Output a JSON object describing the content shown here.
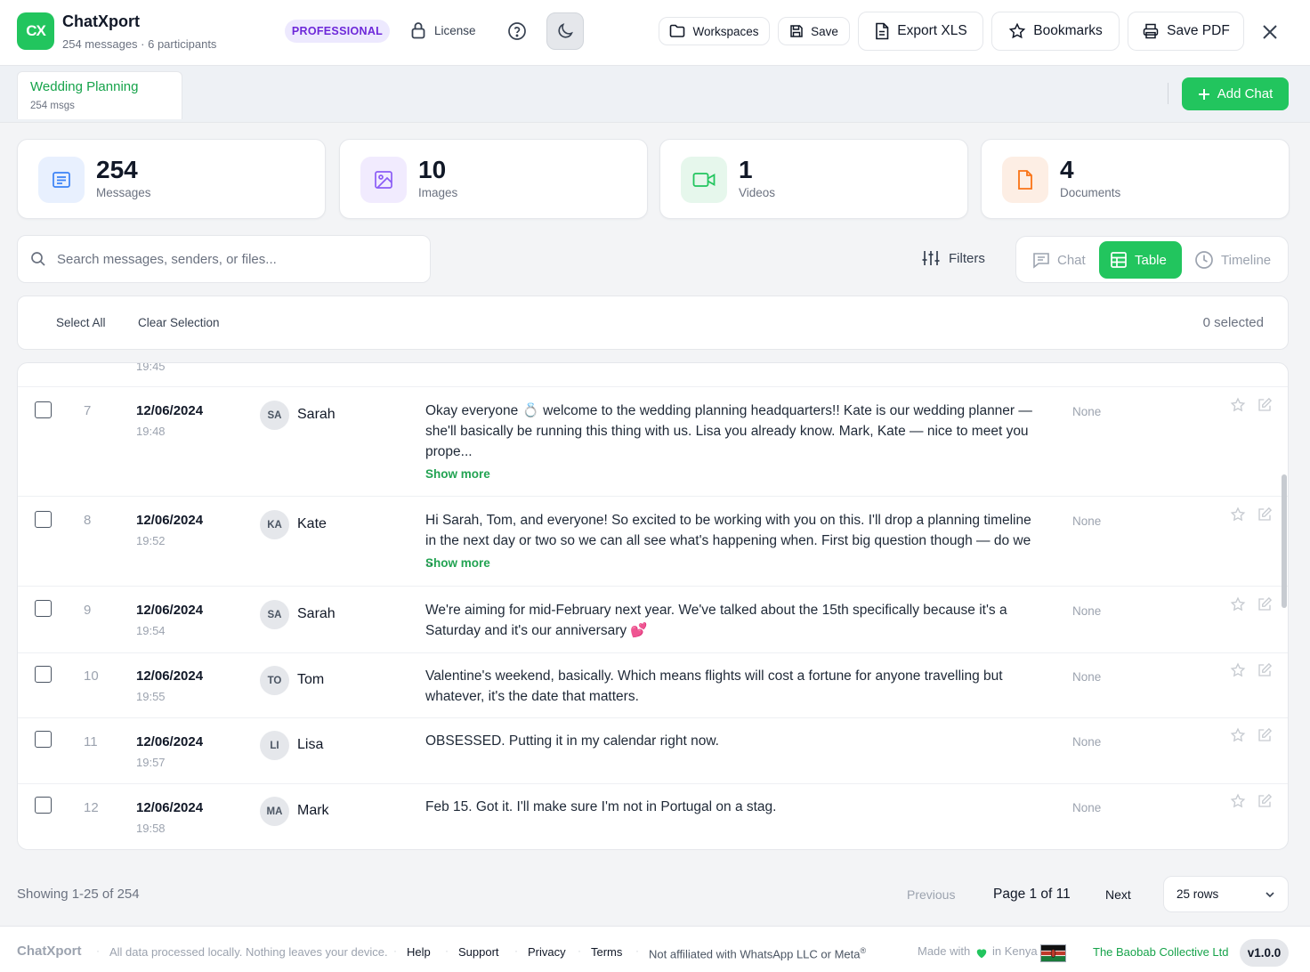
{
  "app": {
    "logo_text": "CX",
    "title": "ChatXport",
    "subtitle": "254 messages · 6 participants",
    "plan_badge": "PROFESSIONAL",
    "license_label": "License"
  },
  "toolbar": {
    "workspaces": "Workspaces",
    "save": "Save",
    "export_xls": "Export XLS",
    "bookmarks": "Bookmarks",
    "save_pdf": "Save PDF"
  },
  "chat_tab": {
    "title": "Wedding Planning",
    "subtitle": "254 msgs"
  },
  "add_chat": "Add Chat",
  "stats": [
    {
      "value": "254",
      "label": "Messages",
      "icon": "message-icon",
      "color": "#3b82f6"
    },
    {
      "value": "10",
      "label": "Images",
      "icon": "image-icon",
      "color": "#8b5cf6"
    },
    {
      "value": "1",
      "label": "Videos",
      "icon": "video-icon",
      "color": "#22c55e"
    },
    {
      "value": "4",
      "label": "Documents",
      "icon": "document-icon",
      "color": "#f97316"
    }
  ],
  "search": {
    "placeholder": "Search messages, senders, or files..."
  },
  "filters_label": "Filters",
  "views": {
    "chat": "Chat",
    "table": "Table",
    "timeline": "Timeline",
    "active": "Table"
  },
  "selection": {
    "select_all": "Select All",
    "clear": "Clear Selection",
    "count": "0 selected"
  },
  "table": {
    "partial_time": "19:45",
    "rows": [
      {
        "num": "7",
        "date": "12/06/2024",
        "time": "19:48",
        "initials": "SA",
        "sender": "Sarah",
        "text": "Okay everyone 💍 welcome to the wedding planning headquarters!! Kate is our wedding planner — she'll basically be running this thing with us. Lisa you already know. Mark, Kate — nice to meet you prope...",
        "show_more": "Show more",
        "tag": "None"
      },
      {
        "num": "8",
        "date": "12/06/2024",
        "time": "19:52",
        "initials": "KA",
        "sender": "Kate",
        "text": "Hi Sarah, Tom, and everyone! So excited to be working with you on this. I'll drop a planning timeline in the next day or two so we can all see what's happening when. First big question though — do we ...",
        "show_more": "Show more",
        "tag": "None"
      },
      {
        "num": "9",
        "date": "12/06/2024",
        "time": "19:54",
        "initials": "SA",
        "sender": "Sarah",
        "text": "We're aiming for mid-February next year. We've talked about the 15th specifically because it's a Saturday and it's our anniversary 💕",
        "show_more": "",
        "tag": "None"
      },
      {
        "num": "10",
        "date": "12/06/2024",
        "time": "19:55",
        "initials": "TO",
        "sender": "Tom",
        "text": "Valentine's weekend, basically. Which means flights will cost a fortune for anyone travelling but whatever, it's the date that matters.",
        "show_more": "",
        "tag": "None"
      },
      {
        "num": "11",
        "date": "12/06/2024",
        "time": "19:57",
        "initials": "LI",
        "sender": "Lisa",
        "text": "OBSESSED. Putting it in my calendar right now.",
        "show_more": "",
        "tag": "None"
      },
      {
        "num": "12",
        "date": "12/06/2024",
        "time": "19:58",
        "initials": "MA",
        "sender": "Mark",
        "text": "Feb 15. Got it. I'll make sure I'm not in Portugal on a stag.",
        "show_more": "",
        "tag": "None"
      }
    ]
  },
  "pagination": {
    "showing": "Showing 1-25 of 254",
    "previous": "Previous",
    "page": "Page 1 of 11",
    "next": "Next",
    "rows_per_page": "25 rows"
  },
  "footer": {
    "brand": "ChatXport",
    "privacy_note": "All data processed locally. Nothing leaves your device.",
    "links": [
      "Help",
      "Support",
      "Privacy",
      "Terms"
    ],
    "disclaimer": "Not affiliated with WhatsApp LLC or Meta",
    "disclaimer_mark": "®",
    "made_with": "Made with",
    "made_in": "in Kenya",
    "company": "The Baobab Collective Ltd",
    "version": "v1.0.0"
  },
  "colors": {
    "accent": "#22c55e",
    "link_green": "#16a34a",
    "badge_purple": "#6d28d9"
  }
}
